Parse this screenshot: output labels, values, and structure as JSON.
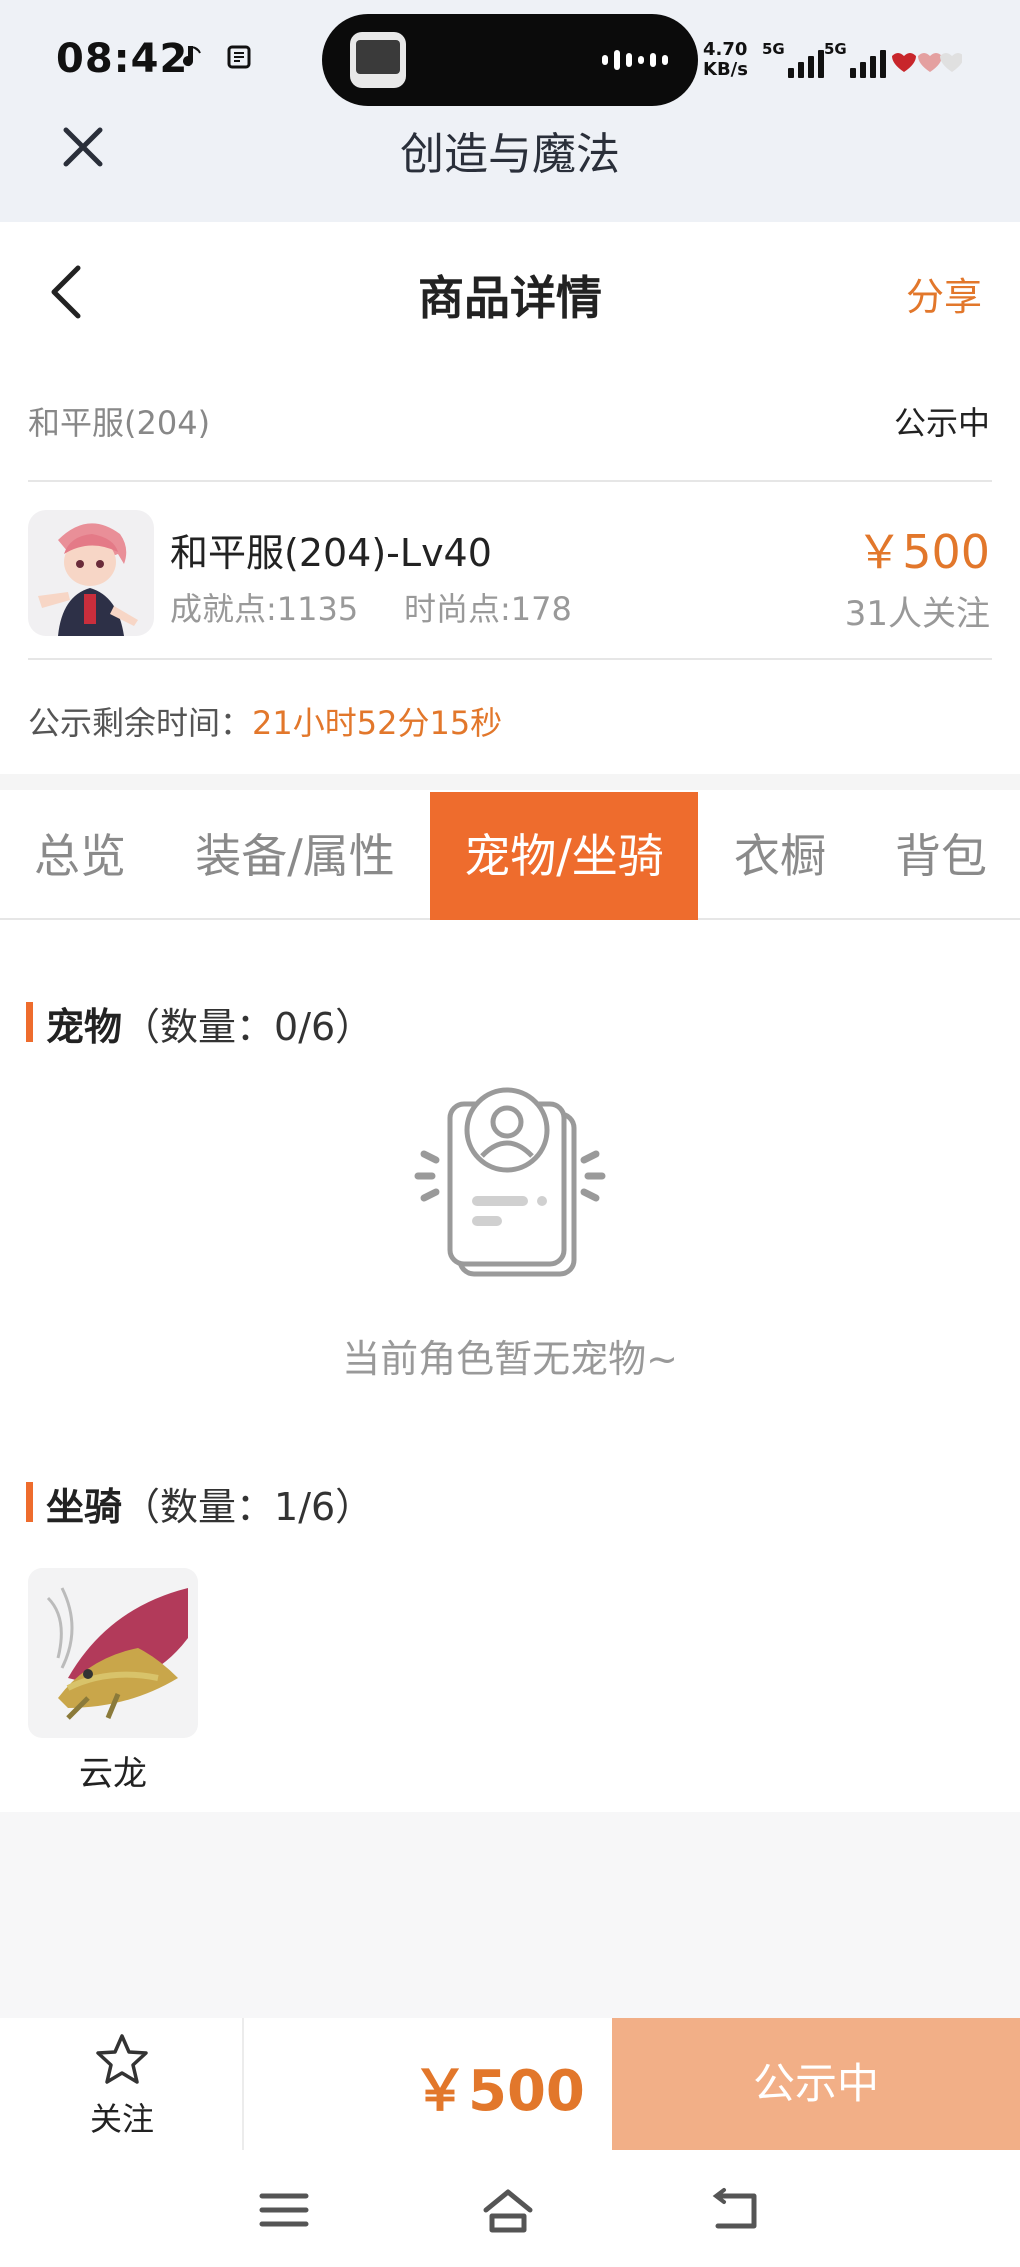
{
  "status_bar": {
    "time": "08:42",
    "network_speed_value": "4.70",
    "network_speed_unit": "KB/s",
    "sim1_label": "5G",
    "sim2_label": "5G",
    "icons": [
      "music-note-icon",
      "sim-tool-icon",
      "signal-icon",
      "battery-icon"
    ]
  },
  "app_header": {
    "title": "创造与魔法"
  },
  "page": {
    "title": "商品详情",
    "share_label": "分享"
  },
  "listing": {
    "server": "和平服(204)",
    "status": "公示中",
    "item_name": "和平服(204)-Lv40",
    "achievement_points": "成就点:1135",
    "fashion_points": "时尚点:178",
    "price": "￥500",
    "followers": "31人关注",
    "remaining_label": "公示剩余时间：",
    "remaining_value": "21小时52分15秒"
  },
  "tabs": [
    {
      "label": "总览",
      "active": false
    },
    {
      "label": "装备/属性",
      "active": false
    },
    {
      "label": "宠物/坐骑",
      "active": true
    },
    {
      "label": "衣橱",
      "active": false
    },
    {
      "label": "背包",
      "active": false
    }
  ],
  "pets": {
    "title": "宠物",
    "count_text": "（数量：0/6）",
    "empty_text": "当前角色暂无宠物~"
  },
  "mounts": {
    "title": "坐骑",
    "count_text": "（数量：1/6）",
    "items": [
      {
        "name": "云龙"
      }
    ]
  },
  "action_bar": {
    "follow_label": "关注",
    "price": "￥500",
    "status_button": "公示中"
  },
  "colors": {
    "accent": "#ee6c2d",
    "price": "#e2772b",
    "status_button": "#f2af87"
  }
}
